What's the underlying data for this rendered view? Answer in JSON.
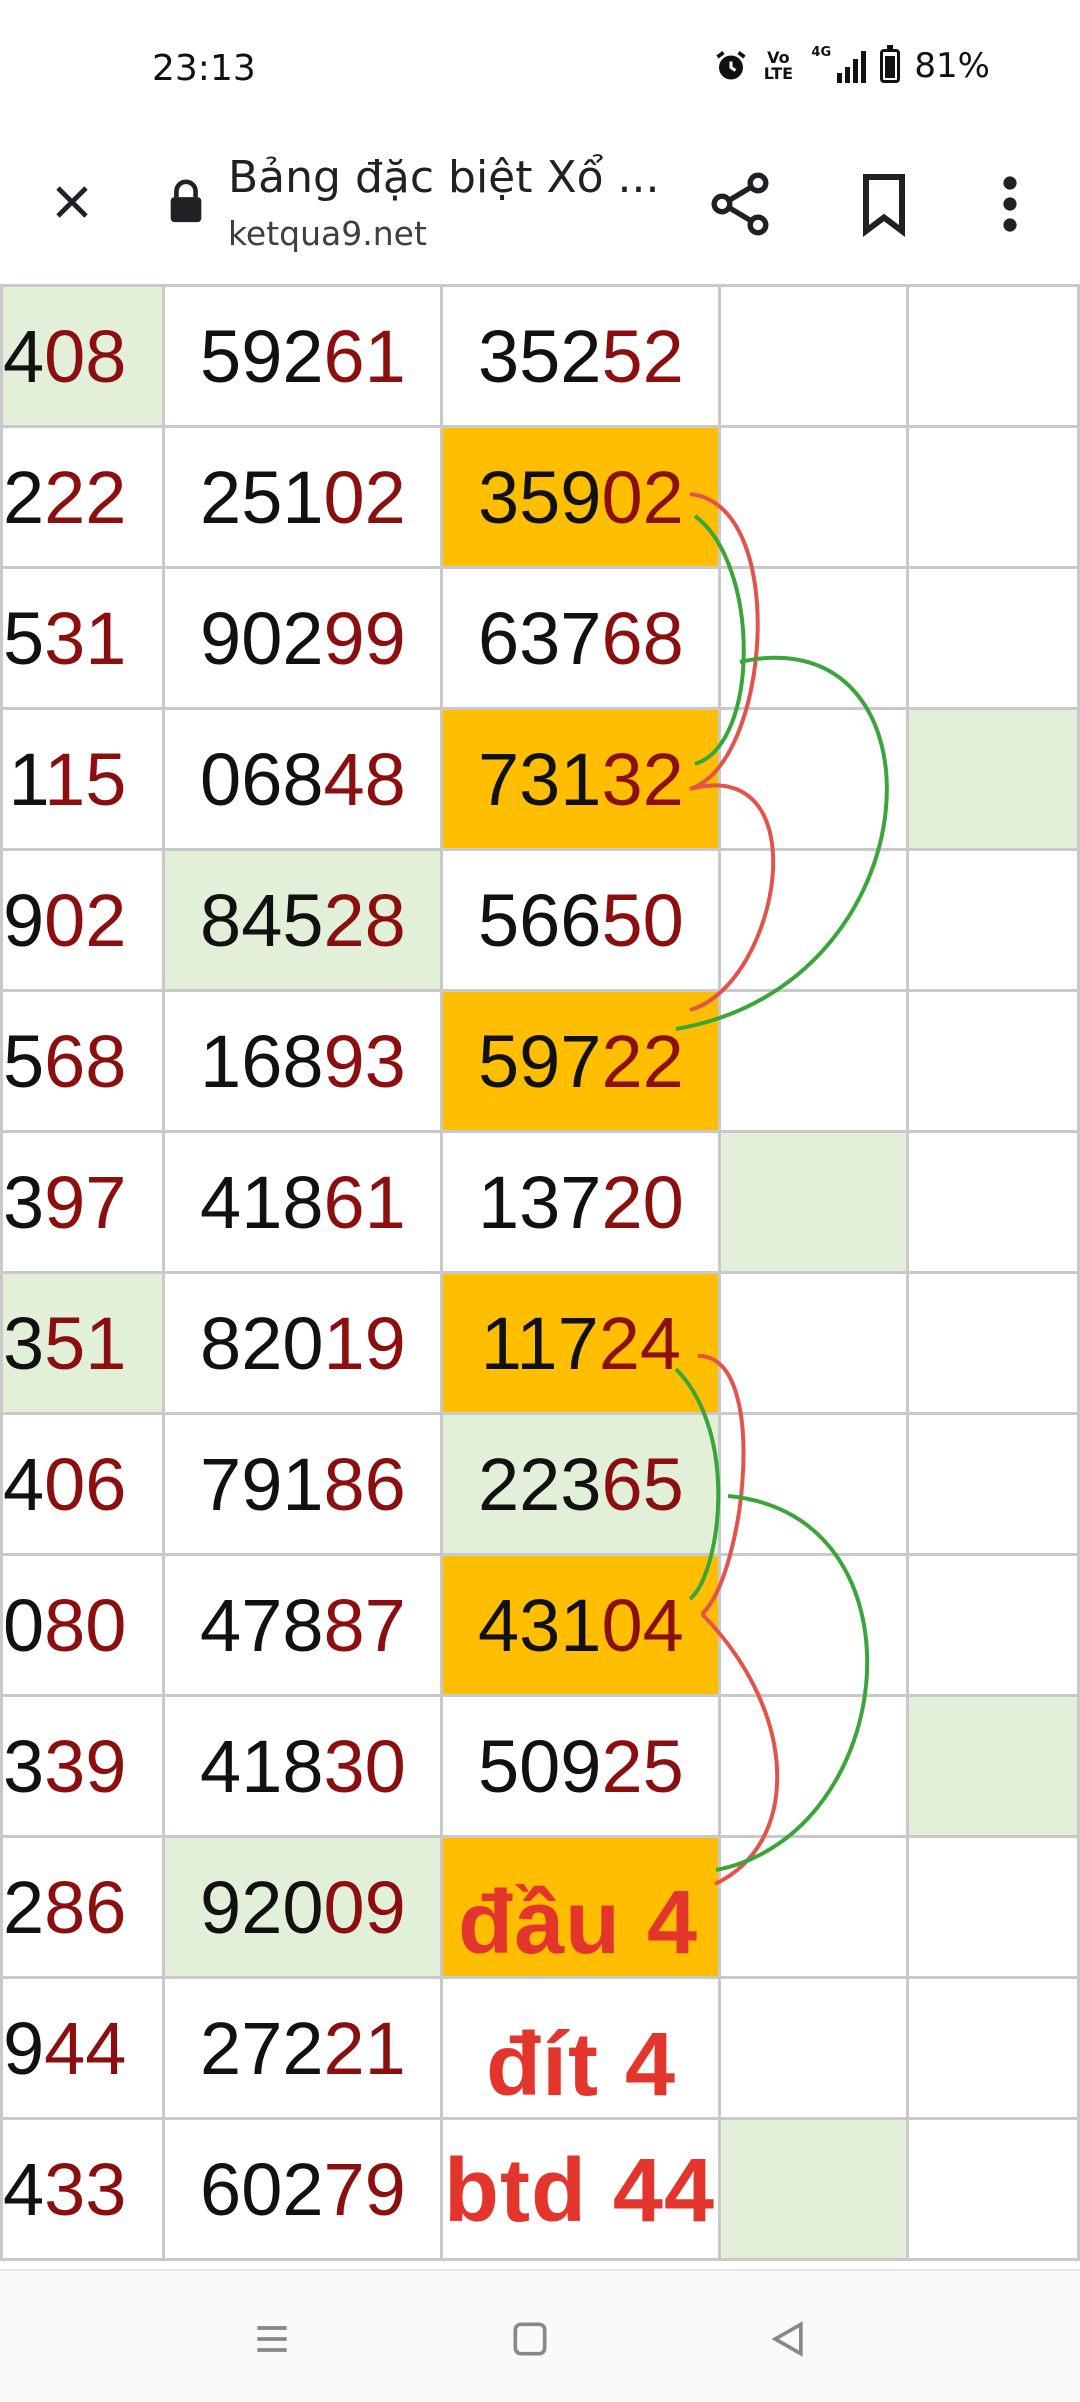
{
  "status_bar": {
    "time": "23:13",
    "volte_label": "Vo LTE",
    "network_label": "4G",
    "battery_percent": "81%",
    "icons": [
      "alarm-icon",
      "volte-icon",
      "signal-icon",
      "battery-icon"
    ]
  },
  "browser": {
    "page_title": "Bảng đặc biệt Xổ ...",
    "url": "ketqua9.net",
    "icons": [
      "close-icon",
      "lock-icon",
      "share-icon",
      "bookmark-icon",
      "more-vert-icon"
    ]
  },
  "table": {
    "rows": [
      [
        {
          "head": "4",
          "tail": "08",
          "bg": "green"
        },
        {
          "head": "592",
          "tail": "61",
          "bg": ""
        },
        {
          "head": "352",
          "tail": "52",
          "bg": ""
        },
        {
          "bg": ""
        },
        {
          "bg": ""
        }
      ],
      [
        {
          "head": "2",
          "tail": "22",
          "bg": ""
        },
        {
          "head": "251",
          "tail": "02",
          "bg": ""
        },
        {
          "head": "359",
          "tail": "02",
          "bg": "orange"
        },
        {
          "bg": ""
        },
        {
          "bg": ""
        }
      ],
      [
        {
          "head": "5",
          "tail": "31",
          "bg": ""
        },
        {
          "head": "902",
          "tail": "99",
          "bg": ""
        },
        {
          "head": "637",
          "tail": "68",
          "bg": ""
        },
        {
          "bg": ""
        },
        {
          "bg": ""
        }
      ],
      [
        {
          "head": "1",
          "tail": "15",
          "bg": ""
        },
        {
          "head": "068",
          "tail": "48",
          "bg": ""
        },
        {
          "head": "731",
          "tail": "32",
          "bg": "orange"
        },
        {
          "bg": ""
        },
        {
          "bg": "green"
        }
      ],
      [
        {
          "head": "9",
          "tail": "02",
          "bg": ""
        },
        {
          "head": "845",
          "tail": "28",
          "bg": "green"
        },
        {
          "head": "566",
          "tail": "50",
          "bg": ""
        },
        {
          "bg": ""
        },
        {
          "bg": ""
        }
      ],
      [
        {
          "head": "5",
          "tail": "68",
          "bg": ""
        },
        {
          "head": "168",
          "tail": "93",
          "bg": ""
        },
        {
          "head": "597",
          "tail": "22",
          "bg": "orange"
        },
        {
          "bg": ""
        },
        {
          "bg": ""
        }
      ],
      [
        {
          "head": "3",
          "tail": "97",
          "bg": ""
        },
        {
          "head": "418",
          "tail": "61",
          "bg": ""
        },
        {
          "head": "137",
          "tail": "20",
          "bg": ""
        },
        {
          "bg": "green"
        },
        {
          "bg": ""
        }
      ],
      [
        {
          "head": "3",
          "tail": "51",
          "bg": "green"
        },
        {
          "head": "820",
          "tail": "19",
          "bg": ""
        },
        {
          "head": "117",
          "tail": "24",
          "bg": "orange"
        },
        {
          "bg": ""
        },
        {
          "bg": ""
        }
      ],
      [
        {
          "head": "4",
          "tail": "06",
          "bg": ""
        },
        {
          "head": "791",
          "tail": "86",
          "bg": ""
        },
        {
          "head": "223",
          "tail": "65",
          "bg": "green"
        },
        {
          "bg": ""
        },
        {
          "bg": ""
        }
      ],
      [
        {
          "head": "0",
          "tail": "80",
          "bg": ""
        },
        {
          "head": "478",
          "tail": "87",
          "bg": ""
        },
        {
          "head": "431",
          "tail": "04",
          "bg": "orange"
        },
        {
          "bg": ""
        },
        {
          "bg": ""
        }
      ],
      [
        {
          "head": "3",
          "tail": "39",
          "bg": ""
        },
        {
          "head": "418",
          "tail": "30",
          "bg": ""
        },
        {
          "head": "509",
          "tail": "25",
          "bg": ""
        },
        {
          "bg": ""
        },
        {
          "bg": "green"
        }
      ],
      [
        {
          "head": "2",
          "tail": "86",
          "bg": ""
        },
        {
          "head": "920",
          "tail": "09",
          "bg": "green"
        },
        {
          "head": "",
          "tail": "",
          "bg": "orange"
        },
        {
          "bg": ""
        },
        {
          "bg": ""
        }
      ],
      [
        {
          "head": "9",
          "tail": "44",
          "bg": ""
        },
        {
          "head": "272",
          "tail": "21",
          "bg": ""
        },
        {
          "head": "",
          "tail": "",
          "bg": ""
        },
        {
          "bg": ""
        },
        {
          "bg": ""
        }
      ],
      [
        {
          "head": "4",
          "tail": "33",
          "bg": ""
        },
        {
          "head": "602",
          "tail": "79",
          "bg": ""
        },
        {
          "head": "",
          "tail": "",
          "bg": ""
        },
        {
          "bg": "green"
        },
        {
          "bg": ""
        }
      ]
    ]
  },
  "annotations": {
    "line1": "đầu 4",
    "line2": "đít 4",
    "line3": "btd 44",
    "arrow_colors": {
      "red": "#e4524c",
      "green": "#3aa63a"
    }
  },
  "colors": {
    "highlight_orange": "#ffbf00",
    "highlight_green": "#e2f0da",
    "tail_red": "#8b0f0f",
    "annotation_red": "#e4352d"
  },
  "nav_bar": {
    "icons": [
      "recents-icon",
      "home-icon",
      "back-icon"
    ]
  }
}
